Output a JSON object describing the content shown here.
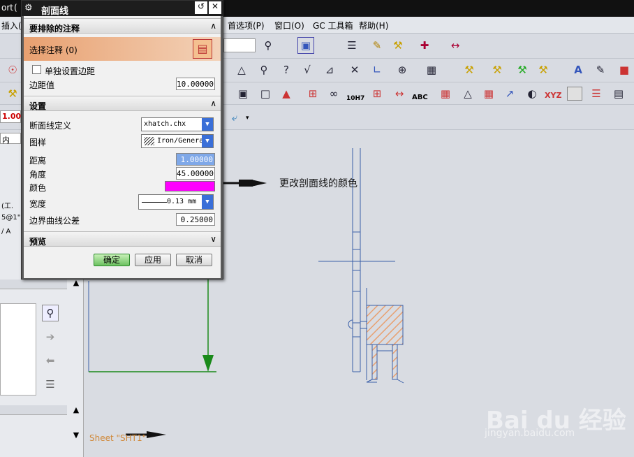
{
  "app_title_fragment": "ort",
  "app_title_close": "(",
  "menu": {
    "insert": "插入(S",
    "preferences": "首选项(P)",
    "window": "窗口(O)",
    "gc_toolbox": "GC 工具箱",
    "help": "帮助(H)"
  },
  "toolbar": {
    "line_width_readout": "1.00",
    "layer_field": "内",
    "tolerance_label": "10H7",
    "abc_label": "ABC",
    "xyz_label": "XYZ"
  },
  "dialog": {
    "title": "剖面线",
    "section_exclude": "要排除的注释",
    "select_annotation": "选择注释 (0)",
    "individual_margin_label": "单独设置边距",
    "margin_label": "边距值",
    "margin_value": "10.00000",
    "section_settings": "设置",
    "hatch_def_label": "断面线定义",
    "hatch_def_value": "xhatch.chx",
    "pattern_label": "图样",
    "pattern_value": "Iron/General",
    "distance_label": "距离",
    "distance_value": "1.00000",
    "angle_label": "角度",
    "angle_value": "45.00000",
    "color_label": "颜色",
    "color_value": "#ff00ff",
    "width_label": "宽度",
    "width_value": "0.13 mm",
    "boundary_tol_label": "边界曲线公差",
    "boundary_tol_value": "0.25000",
    "section_preview": "预览",
    "ok": "确定",
    "apply": "应用",
    "cancel": "取消"
  },
  "annotation": {
    "text": "更改剖面线的颜色"
  },
  "left_panel": {
    "frag1": "(工.",
    "frag2": "5@1\"",
    "frag3": "/ A"
  },
  "sheet_label": "Sheet \"SHT1\"",
  "watermark": {
    "brand": "Bai du 经验",
    "url": "jingyan.baidu.com"
  },
  "colors": {
    "hatch": "#e8a070",
    "accent_green": "#1a8a1a",
    "drawing_blue": "#3a5fa8"
  }
}
